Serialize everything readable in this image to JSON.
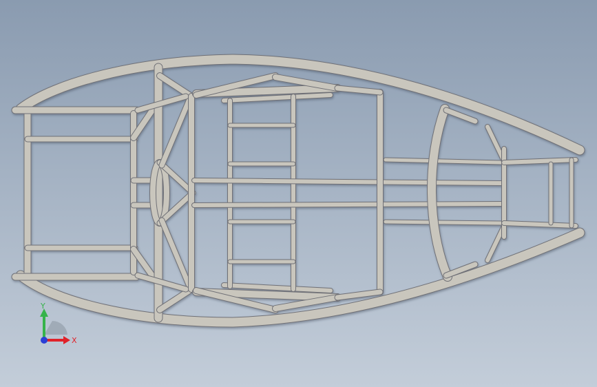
{
  "viewport": {
    "model": "tube-frame-chassis",
    "view": "top",
    "background_top": "#8a9bb0",
    "background_bottom": "#c3cdd9",
    "tube_color": "#c9c6bd"
  },
  "triad": {
    "x_label": "X",
    "y_label": "Y",
    "x_color": "#e0222a",
    "y_color": "#36b34a",
    "z_color": "#2b3fd6"
  }
}
